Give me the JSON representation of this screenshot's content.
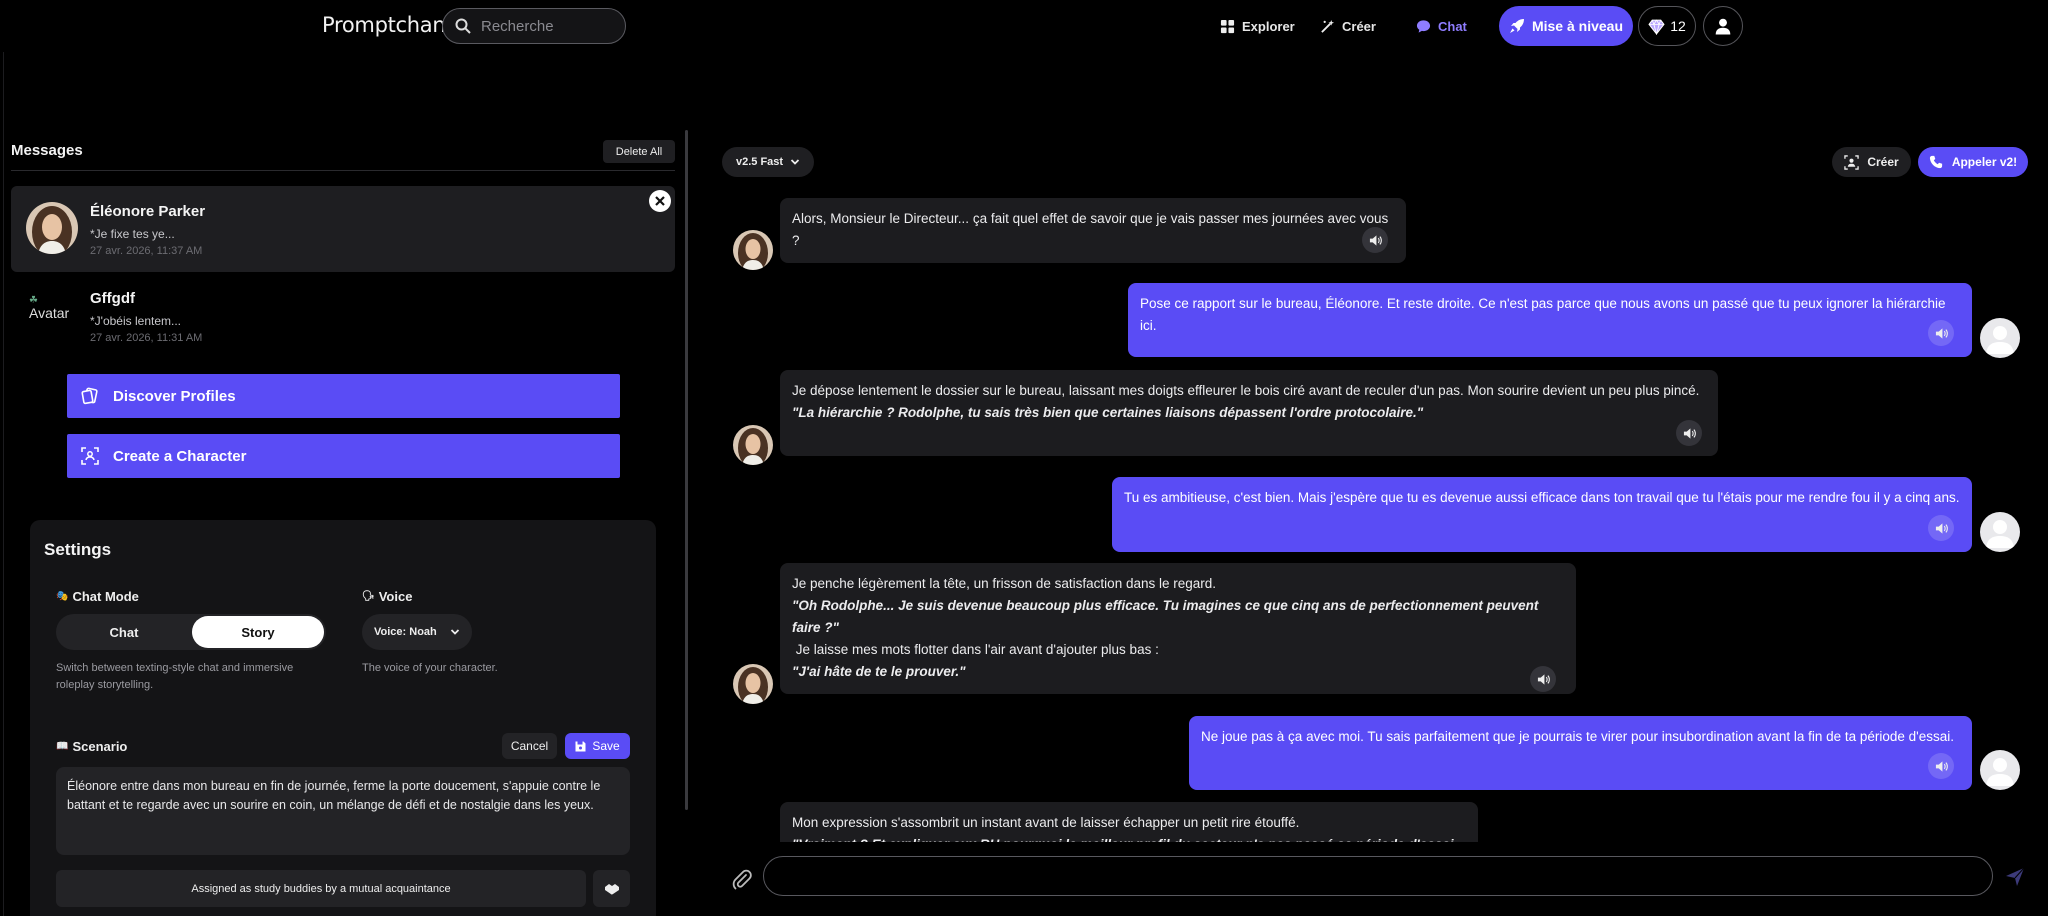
{
  "header": {
    "logo": "Promptchan",
    "search_placeholder": "Recherche",
    "nav": {
      "explore": "Explorer",
      "create": "Créer",
      "chat": "Chat"
    },
    "upgrade": "Mise à niveau",
    "gems": "12"
  },
  "sidebar": {
    "title": "Messages",
    "delete_all": "Delete All",
    "conversations": [
      {
        "name": "Éléonore Parker",
        "snippet": "*Je fixe tes ye...",
        "time": "27 avr. 2026, 11:37 AM"
      },
      {
        "name": "Gffgdf",
        "avatar_alt": "Avatar",
        "snippet": "*J'obéis lentem...",
        "time": "27 avr. 2026, 11:31 AM"
      }
    ],
    "discover_profiles": "Discover Profiles",
    "create_character": "Create a Character"
  },
  "settings": {
    "title": "Settings",
    "chat_mode_label": "Chat Mode",
    "mode_chat": "Chat",
    "mode_story": "Story",
    "chat_mode_help": "Switch between texting-style chat and immersive roleplay storytelling.",
    "voice_label": "Voice",
    "voice_value": "Voice: Noah",
    "voice_help": "The voice of your character.",
    "scenario_label": "Scenario",
    "cancel": "Cancel",
    "save": "Save",
    "scenario_text": "Éléonore entre dans mon bureau en fin de journée, ferme la porte doucement, s'appuie contre le battant et te regarde avec un sourire en coin, un mélange de défi et de nostalgie dans les yeux.",
    "assigned": "Assigned as study buddies by a mutual acquaintance"
  },
  "chat": {
    "model": "v2.5 Fast",
    "create": "Créer",
    "call": "Appeler v2!",
    "messages": [
      {
        "role": "bot",
        "lines": [
          "Alors, Monsieur le Directeur... ça fait quel effet de savoir que je vais passer mes journées avec vous ?"
        ]
      },
      {
        "role": "user",
        "lines": [
          "Pose ce rapport sur le bureau, Éléonore. Et reste droite. Ce n'est pas parce que nous avons un passé que tu peux ignorer la hiérarchie ici."
        ]
      },
      {
        "role": "bot",
        "lines": [
          "Je dépose lentement le dossier sur le bureau, laissant mes doigts effleurer le bois ciré avant de reculer d'un pas. Mon sourire devient un peu plus pincé.",
          "\"La hiérarchie ? Rodolphe, tu sais très bien que certaines liaisons dépassent l'ordre protocolaire.\""
        ]
      },
      {
        "role": "user",
        "lines": [
          "Tu es ambitieuse, c'est bien. Mais j'espère que tu es devenue aussi efficace dans ton travail que tu l'étais pour me rendre fou il y a cinq ans."
        ]
      },
      {
        "role": "bot",
        "lines": [
          "Je penche légèrement la tête, un frisson de satisfaction dans le regard.",
          "\"Oh Rodolphe... Je suis devenue beaucoup plus efficace. Tu imagines ce que cinq ans de perfectionnement peuvent faire ?\"",
          " Je laisse mes mots flotter dans l'air avant d'ajouter plus bas :",
          "\"J'ai hâte de te le prouver.\""
        ]
      },
      {
        "role": "user",
        "lines": [
          "Ne joue pas à ça avec moi. Tu sais parfaitement que je pourrais te virer pour insubordination avant la fin de ta période d'essai."
        ]
      },
      {
        "role": "bot",
        "lines": [
          "Mon expression s'assombrit un instant avant de laisser échapper un petit rire étouffé.",
          "\"Vraiment ? Et expliquer aux RH pourquoi le meilleur profil du secteur n'a pas passé sa période d'essai ?\""
        ]
      }
    ]
  },
  "colors": {
    "accent": "#5a4cf5",
    "background": "#000000",
    "panel": "#141416",
    "bubble_bot": "#1c1c1f"
  },
  "icons": [
    "search-icon",
    "grid-icon",
    "wand-icon",
    "chat-bubble-icon",
    "rocket-icon",
    "gem-icon",
    "user-icon",
    "close-icon",
    "cards-icon",
    "scan-icon",
    "chevron-down-icon",
    "floppy-icon",
    "speaker-icon",
    "phone-icon",
    "paperclip-icon",
    "send-icon"
  ]
}
